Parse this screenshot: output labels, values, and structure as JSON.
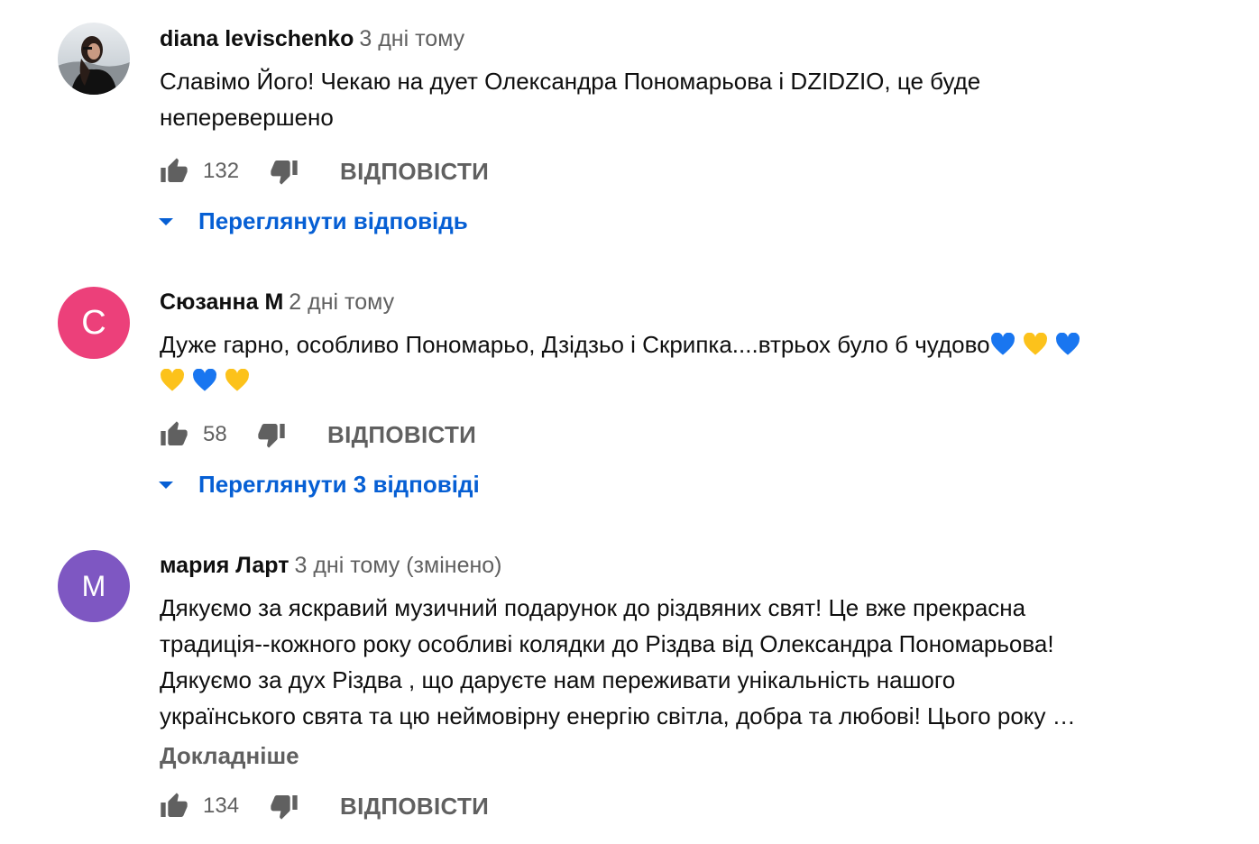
{
  "colors": {
    "link": "#065fd4",
    "secondary_text": "#606060",
    "avatar_c": "#ec407a",
    "avatar_m": "#7e57c2",
    "heart_blue": "#1976f0",
    "heart_yellow": "#fcc21b"
  },
  "comments": [
    {
      "author": "diana levischenko",
      "time": "3 дні тому",
      "avatar_type": "photo",
      "text_lines": [
        "Славімо Його! Чекаю на дует Олександра Пономарьова і DZIDZIO, це буде",
        "неперевершено"
      ],
      "likes": "132",
      "reply_label": "ВІДПОВІСТИ",
      "view_replies": "Переглянути відповідь"
    },
    {
      "author": "Сюзанна М",
      "time": "2 дні тому",
      "avatar_type": "letter",
      "avatar_letter": "С",
      "text_line1": "Дуже гарно, особливо Пономарьо, Дзідзьо і Скрипка....втрьох було б чудово",
      "emoji_line1": [
        "blue-heart",
        "yellow-heart",
        "blue-heart"
      ],
      "emoji_line2": [
        "yellow-heart",
        "blue-heart",
        "yellow-heart"
      ],
      "likes": "58",
      "reply_label": "ВІДПОВІСТИ",
      "view_replies": "Переглянути 3 відповіді"
    },
    {
      "author": "мария Ларт",
      "time": "3 дні тому (змінено)",
      "avatar_type": "letter",
      "avatar_letter": "М",
      "text_lines": [
        "Дякуємо за яскравий музичний подарунок до різдвяних свят! Це вже прекрасна",
        "традиція--кожного року особливі колядки до Різдва від Олександра Пономарьова!",
        "Дякуємо за дух Різдва , що даруєте нам переживати унікальність нашого",
        "українського свята та цю неймовірну енергію світла, добра та любові! Цього року …"
      ],
      "read_more": "Докладніше",
      "likes": "134",
      "reply_label": "ВІДПОВІСТИ"
    }
  ]
}
